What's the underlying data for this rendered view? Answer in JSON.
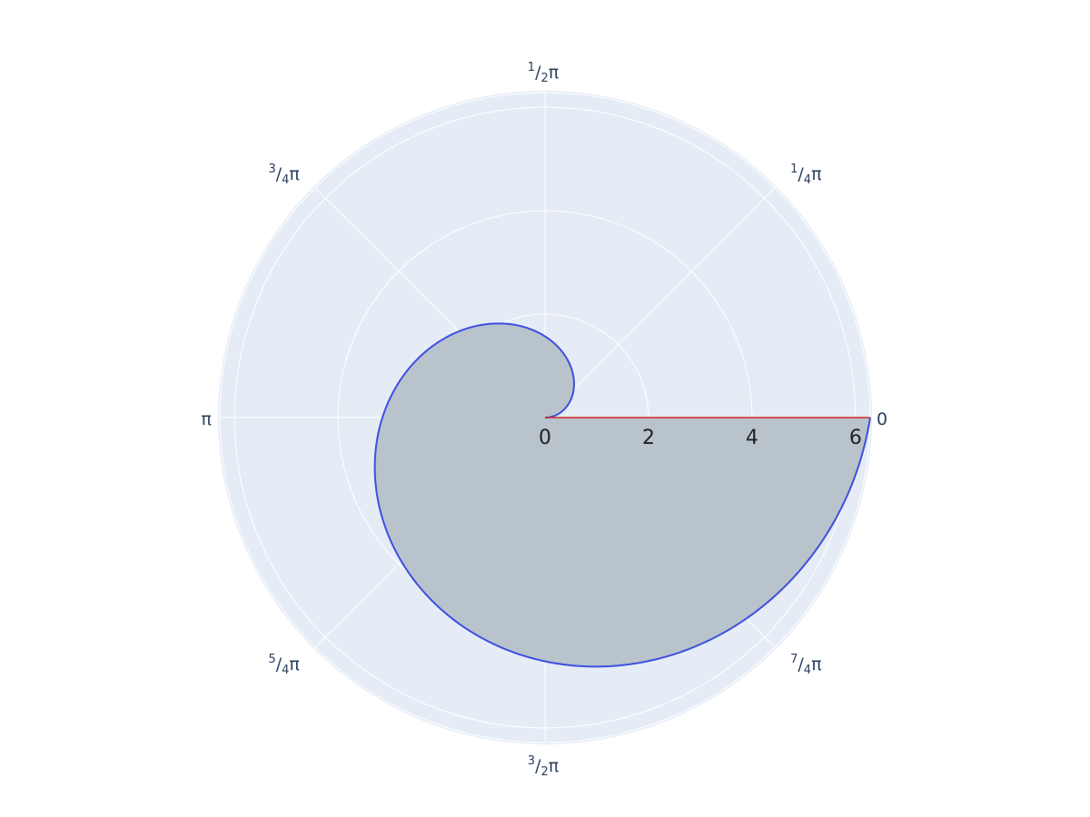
{
  "chart_data": {
    "type": "polar",
    "title": "",
    "polar_bg": "#e5ecf6",
    "grid_color": "#ffffff",
    "radial_axis": {
      "range": [
        0,
        6.283
      ],
      "ticks": [
        0,
        2,
        4,
        6
      ],
      "tick_labels": [
        "0",
        "2",
        "4",
        "6"
      ],
      "angle_deg": 0,
      "line_color": "#d62728"
    },
    "angular_axis": {
      "ticks_deg": [
        0,
        45,
        90,
        135,
        180,
        225,
        270,
        315
      ],
      "tick_labels": [
        {
          "num": "",
          "den": "",
          "suffix": "0"
        },
        {
          "num": "1",
          "den": "4",
          "suffix": "π"
        },
        {
          "num": "1",
          "den": "2",
          "suffix": "π"
        },
        {
          "num": "3",
          "den": "4",
          "suffix": "π"
        },
        {
          "num": "",
          "den": "",
          "suffix": "π"
        },
        {
          "num": "5",
          "den": "4",
          "suffix": "π"
        },
        {
          "num": "3",
          "den": "2",
          "suffix": "π"
        },
        {
          "num": "7",
          "den": "4",
          "suffix": "π"
        }
      ]
    },
    "series": [
      {
        "type": "spiral",
        "equation": "r = theta",
        "theta_range": [
          0,
          6.283
        ],
        "line_color": "#3f4fe0",
        "fill_color": "#b8c3cc"
      }
    ]
  }
}
